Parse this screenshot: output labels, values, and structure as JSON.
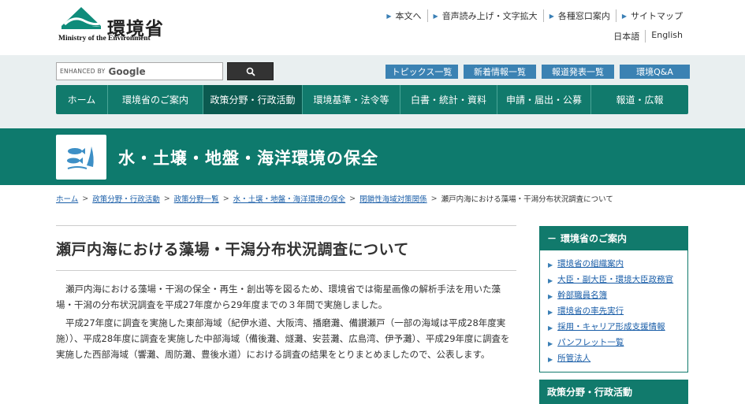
{
  "header": {
    "logo_jp": "環境省",
    "logo_en": "Ministry of the Environment",
    "util_links": [
      "本文へ",
      "音声読み上げ・文字拡大",
      "各種窓口案内",
      "サイトマップ"
    ],
    "lang_links": [
      "日本語",
      "English"
    ]
  },
  "search": {
    "enhanced_label": "ENHANCED BY",
    "google_label": "Google"
  },
  "topic_links": [
    "トピックス一覧",
    "新着情報一覧",
    "報道発表一覧",
    "環境Q&A"
  ],
  "gnav": [
    "ホーム",
    "環境省のご案内",
    "政策分野・行政活動",
    "環境基準・法令等",
    "白書・統計・資料",
    "申請・届出・公募",
    "報道・広報"
  ],
  "banner": {
    "title": "水・土壌・地盤・海洋環境の保全"
  },
  "breadcrumb": {
    "items": [
      "ホーム",
      "政策分野・行政活動",
      "政策分野一覧",
      "水・土壌・地盤・海洋環境の保全",
      "閉鎖性海域対策関係"
    ],
    "current": "瀬戸内海における藻場・干潟分布状況調査について",
    "separator": ">"
  },
  "main": {
    "title": "瀬戸内海における藻場・干潟分布状況調査について",
    "paragraphs": [
      "瀬戸内海における藻場・干潟の保全・再生・創出等を図るため、環境省では衛星画像の解析手法を用いた藻場・干潟の分布状況調査を平成27年度から29年度までの３年間で実施しました。",
      "平成27年度に調査を実施した東部海域（紀伊水道、大阪湾、播磨灘、備讃瀬戸（一部の海域は平成28年度実施））、平成28年度に調査を実施した中部海域（備後灘、燧灘、安芸灘、広島湾、伊予灘）、平成29年度に調査を実施した西部海域（響灘、周防灘、豊後水道）における調査の結果をとりまとめましたので、公表します。"
    ]
  },
  "sidebar": {
    "heading": "環境省のご案内",
    "heading_dash": "－",
    "items": [
      "環境省の組織案内",
      "大臣・副大臣・環境大臣政務官",
      "幹部職員名簿",
      "環境省の率先実行",
      "採用・キャリア形成支援情報",
      "パンフレット一覧",
      "所管法人"
    ],
    "heading2": "政策分野・行政活動"
  },
  "colors": {
    "brand_green": "#117a6c",
    "link_blue": "#1a5ea8",
    "topic_blue": "#3b82b3"
  }
}
